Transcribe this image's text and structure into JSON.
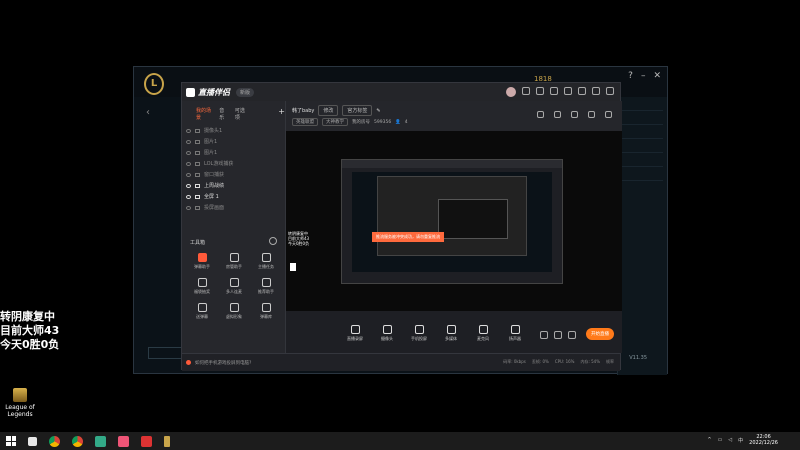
{
  "overlay_text": [
    "转阴康复中",
    "目前大师43",
    "今天0胜0负"
  ],
  "desktop_icon": {
    "label": "League of Legends"
  },
  "lol_client": {
    "logo": "L",
    "stats_text": "1818",
    "right_rows": [
      "",
      "",
      "",
      "",
      "",
      "",
      ""
    ],
    "version_text": "V11.35"
  },
  "stream_app": {
    "name": "直播伴侣",
    "version_badge": "新版",
    "left_tabs": [
      "我的场景",
      "音乐",
      "可选项"
    ],
    "add_label": "+",
    "scenes": [
      {
        "label": "摄像头1",
        "on": false
      },
      {
        "label": "图片1",
        "on": false
      },
      {
        "label": "图片1",
        "on": false
      },
      {
        "label": "LOL游戏捕获",
        "on": false
      },
      {
        "label": "窗口捕获",
        "on": false
      },
      {
        "label": "上周战绩",
        "on": true
      },
      {
        "label": "全屏 1",
        "on": true
      },
      {
        "label": "投屏画面",
        "on": false
      }
    ],
    "toolbox_title": "工具箱",
    "tools": [
      {
        "label": "弹幕助手",
        "hot": true,
        "badge": ""
      },
      {
        "label": "房管助手",
        "hot": false,
        "badge": ""
      },
      {
        "label": "主播任务",
        "hot": false,
        "badge": ""
      },
      {
        "label": "福袋抽奖",
        "hot": false,
        "badge": ""
      },
      {
        "label": "多人连麦",
        "hot": false,
        "badge": ""
      },
      {
        "label": "推荐助手",
        "hot": false,
        "badge": ""
      },
      {
        "label": "送弹幕",
        "hot": false,
        "badge": ""
      },
      {
        "label": "虚拟形象",
        "hot": false,
        "badge": ""
      },
      {
        "label": "弹幕库",
        "hot": false,
        "badge": ""
      }
    ],
    "footer_tip": "如何把手机游戏投屏到电脑?",
    "info": {
      "title": "韩了baby",
      "edit_label": "修改",
      "tag_label": "官方标签",
      "category": "英雄联盟",
      "sub_category": "大神教学",
      "room_label": "我的房号",
      "room_id": "599356",
      "viewers": "4"
    },
    "preview": {
      "toast": "推流服务被冲突成功，请勿重复推流",
      "caption": [
        "转阴康复中",
        "目前大师43",
        "今天0胜0负"
      ]
    },
    "controls": [
      {
        "label": "直播录屏"
      },
      {
        "label": "摄像头"
      },
      {
        "label": "手机投屏"
      },
      {
        "label": "多媒体"
      },
      {
        "label": "麦克风"
      },
      {
        "label": "扬声器"
      }
    ],
    "start_label": "开始直播",
    "status_stats": [
      "码率: 0kbps",
      "丢帧: 0%",
      "CPU: 16%",
      "内存: 54%",
      "帧率"
    ]
  },
  "taskbar": {
    "time": "22:06",
    "date": "2022/12/26",
    "ime": "中"
  }
}
